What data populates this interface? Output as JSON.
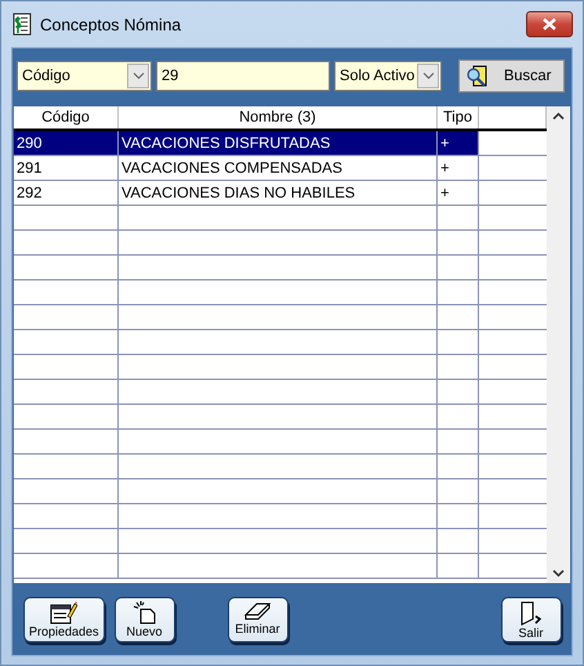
{
  "window": {
    "title": "Conceptos Nómina"
  },
  "filter": {
    "field": "Código",
    "value": "29",
    "status": "Solo Activo",
    "search_button": "Buscar"
  },
  "table": {
    "columns": [
      "Código",
      "Nombre (3)",
      "Tipo"
    ],
    "rows": [
      {
        "code": "290",
        "name": "VACACIONES DISFRUTADAS",
        "type": "+",
        "selected": true
      },
      {
        "code": "291",
        "name": "VACACIONES COMPENSADAS",
        "type": "+",
        "selected": false
      },
      {
        "code": "292",
        "name": "VACACIONES DIAS NO HABILES",
        "type": "+",
        "selected": false
      }
    ]
  },
  "buttons": [
    {
      "kind": "properties",
      "label": "Propiedades"
    },
    {
      "kind": "new",
      "label": "Nuevo"
    },
    {
      "kind": "delete",
      "label": "Eliminar"
    },
    {
      "kind": "exit",
      "label": "Salir"
    }
  ]
}
